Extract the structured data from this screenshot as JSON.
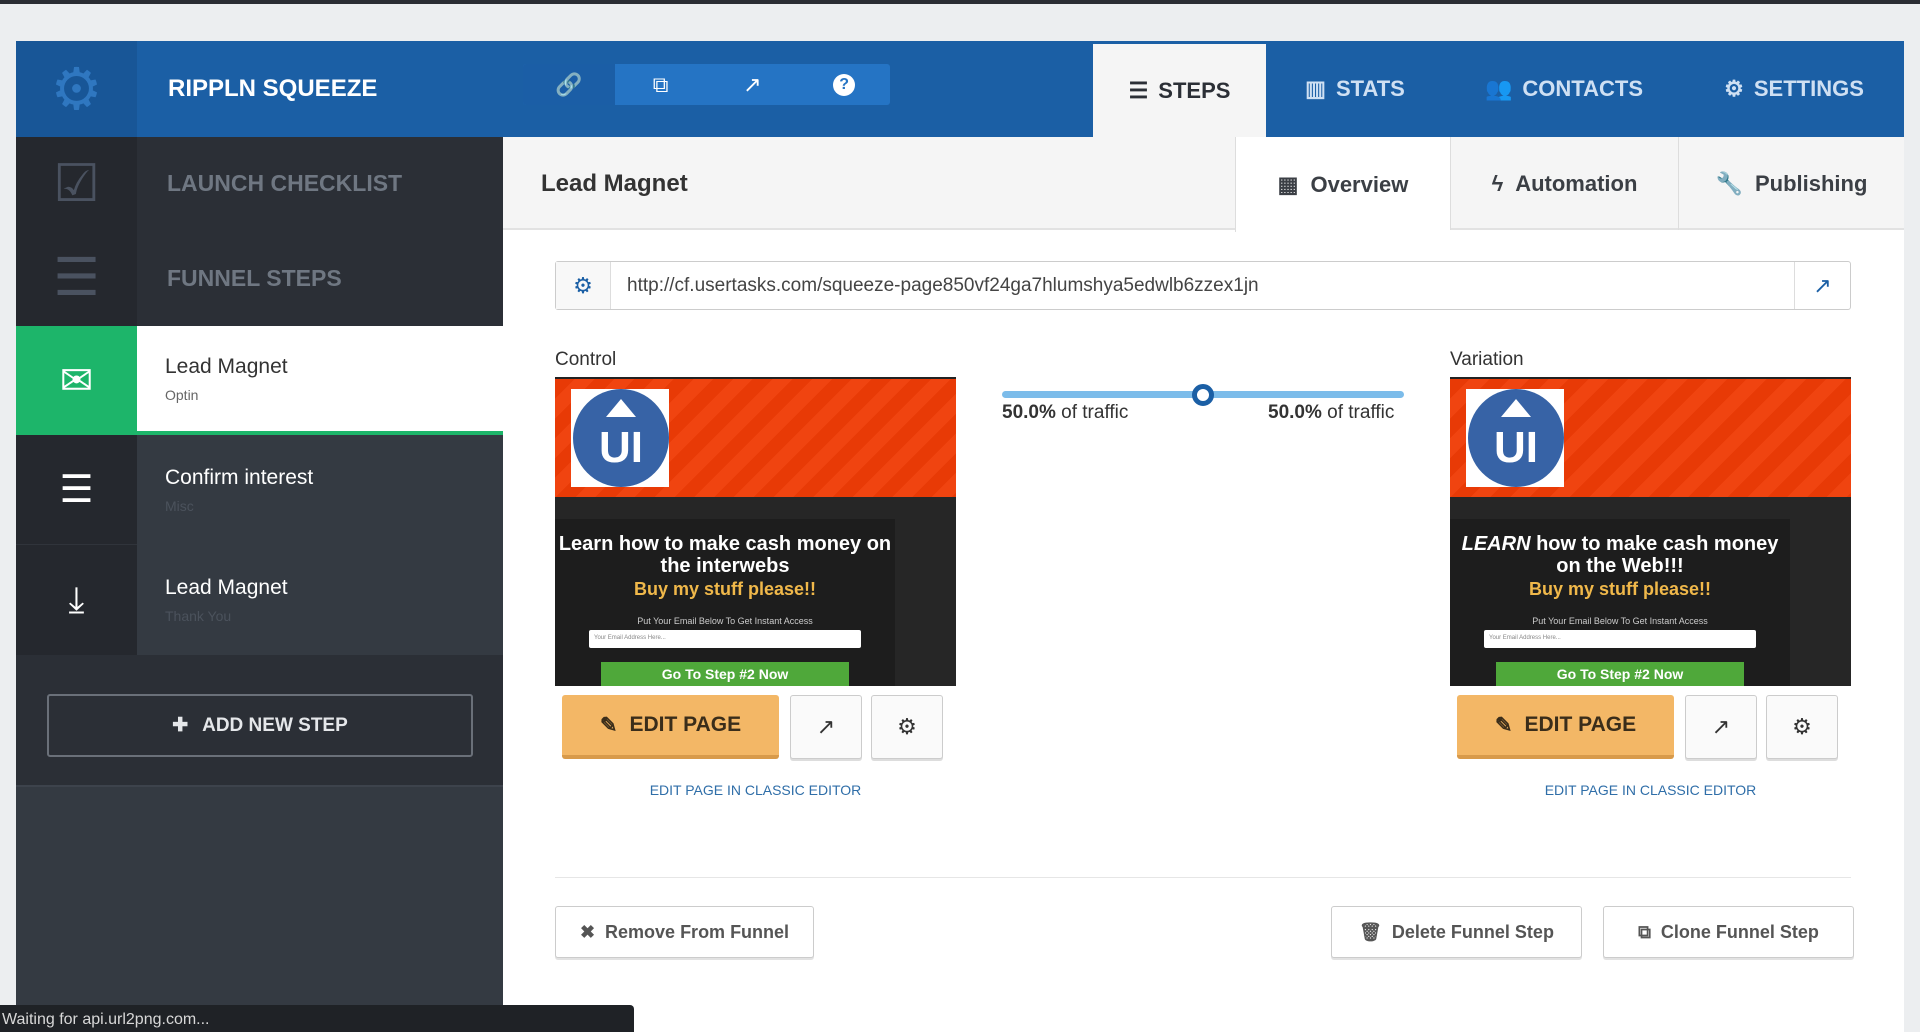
{
  "app": {
    "name": "RIPPLN SQUEEZE",
    "logo_icon": "gear-icon"
  },
  "toolbar": [
    {
      "icon": "link-icon",
      "glyph": "🔗"
    },
    {
      "icon": "copy-icon",
      "glyph": "⧉"
    },
    {
      "icon": "external-link-icon",
      "glyph": "↗"
    },
    {
      "icon": "help-icon",
      "glyph": "?"
    }
  ],
  "nav": {
    "tabs": [
      {
        "label": "STEPS",
        "glyph": "☰",
        "active": true
      },
      {
        "label": "STATS",
        "glyph": "▥"
      },
      {
        "label": "CONTACTS",
        "glyph": "👥"
      },
      {
        "label": "SETTINGS",
        "glyph": "⚙"
      }
    ]
  },
  "sidebar": {
    "launch_checklist": "LAUNCH CHECKLIST",
    "funnel_steps": "FUNNEL STEPS",
    "steps": [
      {
        "title": "Lead Magnet",
        "subtitle": "Optin",
        "icon": "envelope-icon",
        "active": true
      },
      {
        "title": "Confirm interest",
        "subtitle": "Misc",
        "icon": "list-icon"
      },
      {
        "title": "Lead Magnet",
        "subtitle": "Thank You",
        "icon": "download-icon"
      }
    ],
    "add_step": "ADD NEW STEP"
  },
  "page": {
    "title": "Lead Magnet",
    "subtabs": [
      {
        "label": "Overview",
        "glyph": "▦",
        "active": true
      },
      {
        "label": "Automation",
        "glyph": "ϟ"
      },
      {
        "label": "Publishing",
        "glyph": "🔧"
      }
    ],
    "url": "http://cf.usertasks.com/squeeze-page850vf24ga7hlumshya5edwlb6zzex1jn"
  },
  "control": {
    "label": "Control",
    "headline": "Learn how to make cash money on the interwebs",
    "headline_em": "",
    "subhead": "Buy my stuff please!!",
    "prompt": "Put Your Email Below To Get Instant Access",
    "input_ph": "Your Email Address Here...",
    "cta": "Go To Step #2 Now",
    "traffic_pct": "50.0%"
  },
  "variation": {
    "label": "Variation",
    "headline": "how to make cash money on the Web!!!",
    "headline_em": "LEARN",
    "subhead": "Buy my stuff please!!",
    "prompt": "Put Your Email Below To Get Instant Access",
    "input_ph": "Your Email Address Here...",
    "cta": "Go To Step #2 Now",
    "traffic_pct": "50.0%"
  },
  "split": {
    "control_share": 50,
    "traffic_suffix": "of traffic"
  },
  "edit_page": "EDIT PAGE",
  "classic_editor": "EDIT PAGE IN CLASSIC EDITOR",
  "actions": {
    "remove": "Remove From Funnel",
    "delete": "Delete Funnel Step",
    "clone": "Clone Funnel Step"
  },
  "status_bar": "Waiting for api.url2png.com...",
  "colors": {
    "header": "#1b5fa5",
    "active_step": "#1db56a",
    "edit_button": "#f3b766",
    "slider": "#7cbcea"
  }
}
